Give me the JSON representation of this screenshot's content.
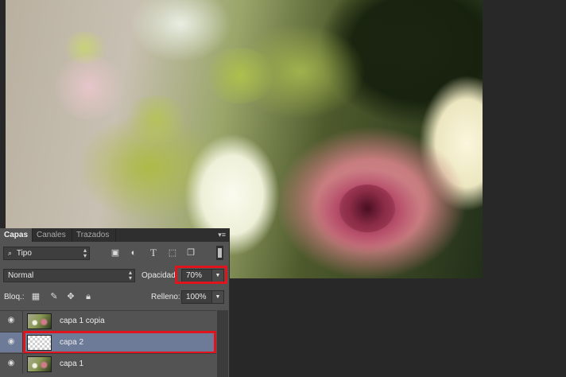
{
  "canvas": {
    "description_icon": "photo-roses"
  },
  "panel": {
    "tabs": [
      {
        "label": "Capas",
        "active": true
      },
      {
        "label": "Canales",
        "active": false
      },
      {
        "label": "Trazados",
        "active": false
      }
    ],
    "menu_icon": "panel-menu-icon",
    "filter": {
      "value": "Tipo",
      "icon": "search-icon"
    },
    "blend_mode": "Normal",
    "opacity_label": "Opacidad:",
    "opacity_value": "70%",
    "lock_label": "Bloq.:",
    "fill_label": "Relleno:",
    "fill_value": "100%",
    "layers": [
      {
        "name": "capa 1 copia",
        "thumb": "photo",
        "selected": false,
        "visible": true
      },
      {
        "name": "capa 2",
        "thumb": "transparent",
        "selected": true,
        "visible": true
      },
      {
        "name": "capa 1",
        "thumb": "photo",
        "selected": false,
        "visible": true
      }
    ]
  },
  "colors": {
    "highlight": "#e0141c",
    "selected_row": "#6d7a98",
    "panel_bg": "#535353"
  }
}
